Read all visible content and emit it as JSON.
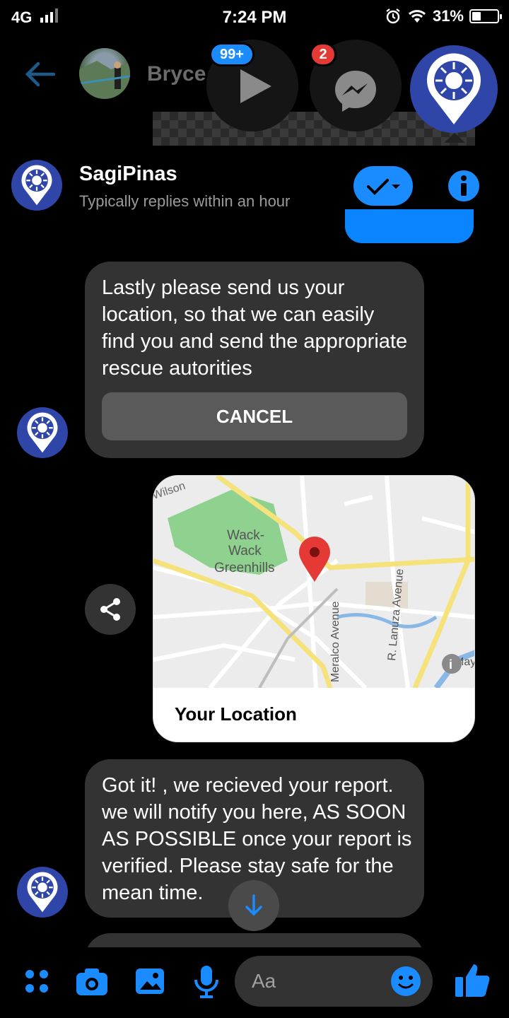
{
  "status_bar": {
    "network": "4G",
    "time": "7:24 PM",
    "battery": "31%",
    "battery_level": 0.31
  },
  "background_chat": {
    "contact_name": "Bryce"
  },
  "chat_heads": [
    {
      "name": "video",
      "badge": "99+"
    },
    {
      "name": "messenger",
      "badge": "2"
    },
    {
      "name": "sagipinas"
    }
  ],
  "page": {
    "name": "SagiPinas",
    "subtitle": "Typically replies within an hour"
  },
  "messages": [
    {
      "text": "Lastly please send us your location, so that we can easily find you and send the appropriate rescue autorities",
      "button": "CANCEL"
    },
    {
      "type": "map",
      "title": "Your Location",
      "map_labels": {
        "wilson": "Wilson",
        "park": "Wack-\nWack\nGreenhills",
        "meralco": "Meralco Avenue",
        "lanuza": "R. Lanuza Avenue",
        "may": "May"
      }
    },
    {
      "text": "Got it! , we recieved your report. we will notify you here, AS SOON AS POSSIBLE once your report is verified. Please stay safe for the mean time."
    }
  ],
  "composer": {
    "placeholder": "Aa"
  },
  "colors": {
    "accent": "#1a8cff",
    "bubble": "#333333",
    "badge_blue": "#1a8cff",
    "badge_red": "#e53935",
    "logo": "#2f45a8"
  }
}
